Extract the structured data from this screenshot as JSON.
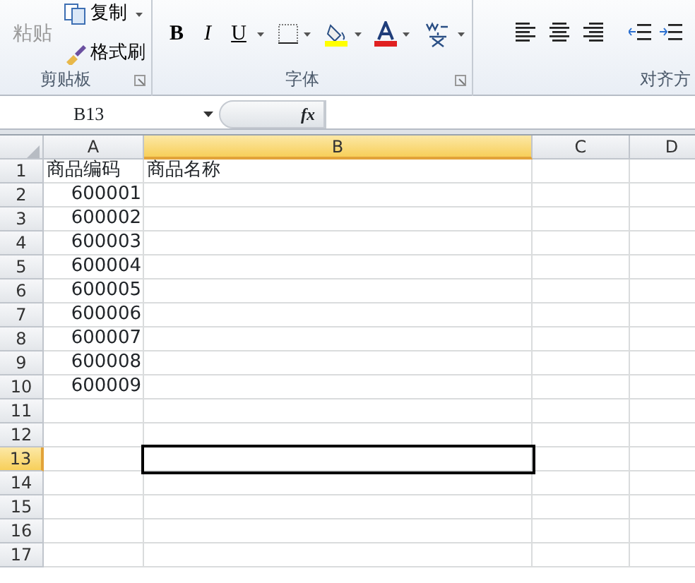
{
  "ribbon": {
    "groups": [
      {
        "kind": "clipboard",
        "label": "剪贴板",
        "paste": {
          "label": "粘贴",
          "disabled": true
        },
        "items": [
          {
            "label": "复制"
          },
          {
            "label": "格式刷"
          }
        ]
      },
      {
        "kind": "font",
        "label": "字体",
        "buttons": [
          {
            "label": "B"
          },
          {
            "label": "I"
          },
          {
            "label": "U"
          }
        ]
      },
      {
        "kind": "align",
        "label": "对齐方"
      }
    ]
  },
  "formula_bar": {
    "name_box": "B13",
    "fx": "fx"
  },
  "sheet": {
    "columns": [
      {
        "label": "A",
        "selected": false
      },
      {
        "label": "B",
        "selected": true
      },
      {
        "label": "C",
        "selected": false
      },
      {
        "label": "D",
        "selected": false
      }
    ],
    "rows": [
      {
        "label": "1",
        "selected": false,
        "cells": [
          "商品编码",
          "商品名称"
        ]
      },
      {
        "label": "2",
        "selected": false,
        "cells": [
          "600001",
          ""
        ]
      },
      {
        "label": "3",
        "selected": false,
        "cells": [
          "600002",
          ""
        ]
      },
      {
        "label": "4",
        "selected": false,
        "cells": [
          "600003",
          ""
        ]
      },
      {
        "label": "5",
        "selected": false,
        "cells": [
          "600004",
          ""
        ]
      },
      {
        "label": "6",
        "selected": false,
        "cells": [
          "600005",
          ""
        ]
      },
      {
        "label": "7",
        "selected": false,
        "cells": [
          "600006",
          ""
        ]
      },
      {
        "label": "8",
        "selected": false,
        "cells": [
          "600007",
          ""
        ]
      },
      {
        "label": "9",
        "selected": false,
        "cells": [
          "600008",
          ""
        ]
      },
      {
        "label": "10",
        "selected": false,
        "cells": [
          "600009",
          ""
        ]
      },
      {
        "label": "11",
        "selected": false,
        "cells": [
          "",
          ""
        ]
      },
      {
        "label": "12",
        "selected": false,
        "cells": [
          "",
          ""
        ]
      },
      {
        "label": "13",
        "selected": true,
        "cells": [
          "",
          ""
        ]
      },
      {
        "label": "14",
        "selected": false,
        "cells": [
          "",
          ""
        ]
      },
      {
        "label": "15",
        "selected": false,
        "cells": [
          "",
          ""
        ]
      },
      {
        "label": "16",
        "selected": false,
        "cells": [
          "",
          ""
        ]
      },
      {
        "label": "17",
        "selected": false,
        "cells": [
          "",
          ""
        ]
      }
    ]
  }
}
